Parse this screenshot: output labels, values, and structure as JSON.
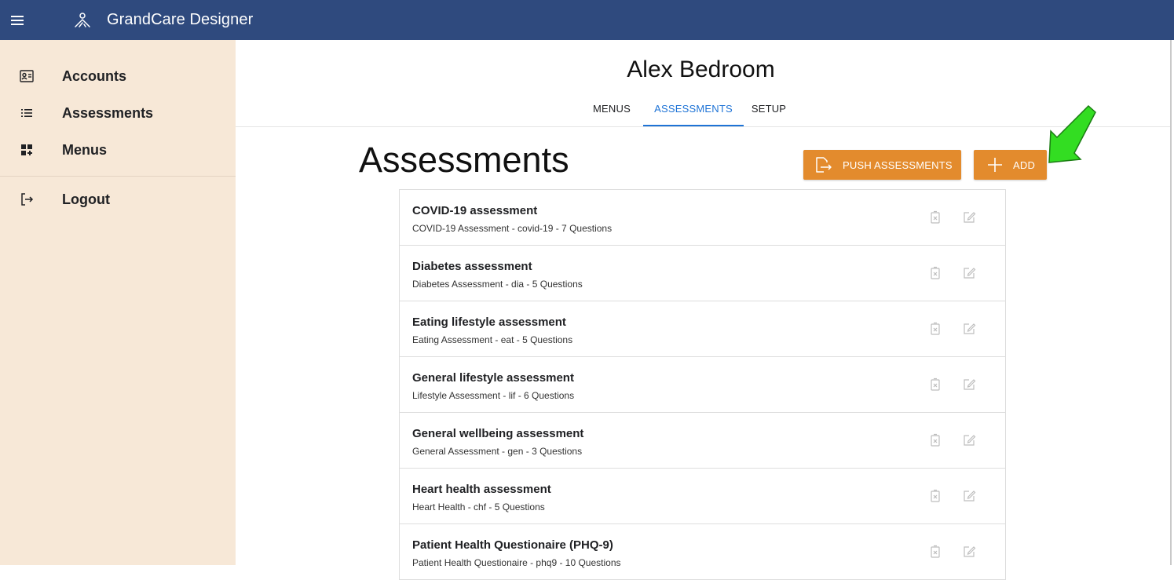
{
  "app": {
    "title": "GrandCare Designer",
    "menu_icon": "hamburger-menu-icon",
    "logo_icon": "people-network-icon",
    "brand_color": "#2f4a7e"
  },
  "sidebar": {
    "items": [
      {
        "label": "Accounts",
        "icon": "contact-card-icon"
      },
      {
        "label": "Assessments",
        "icon": "list-icon"
      },
      {
        "label": "Menus",
        "icon": "dashboard-add-icon"
      },
      {
        "label": "Logout",
        "icon": "logout-icon"
      }
    ]
  },
  "header": {
    "title": "Alex Bedroom",
    "tabs": [
      {
        "label": "MENUS",
        "active": false
      },
      {
        "label": "ASSESSMENTS",
        "active": true
      },
      {
        "label": "SETUP",
        "active": false
      }
    ]
  },
  "section": {
    "title": "Assessments",
    "push_label": "PUSH ASSESSMENTS",
    "add_label": "ADD",
    "accent_color": "#e38b2d"
  },
  "assessments": [
    {
      "title": "COVID-19 assessment",
      "subtitle": "COVID-19 Assessment - covid-19 - 7 Questions"
    },
    {
      "title": "Diabetes assessment",
      "subtitle": "Diabetes Assessment - dia - 5 Questions"
    },
    {
      "title": "Eating lifestyle assessment",
      "subtitle": "Eating Assessment - eat - 5 Questions"
    },
    {
      "title": "General lifestyle assessment",
      "subtitle": "Lifestyle Assessment - lif - 6 Questions"
    },
    {
      "title": "General wellbeing assessment",
      "subtitle": "General Assessment - gen - 3 Questions"
    },
    {
      "title": "Heart health assessment",
      "subtitle": "Heart Health - chf - 5 Questions"
    },
    {
      "title": "Patient Health Questionaire (PHQ-9)",
      "subtitle": "Patient Health Questionaire - phq9 - 10 Questions"
    }
  ]
}
